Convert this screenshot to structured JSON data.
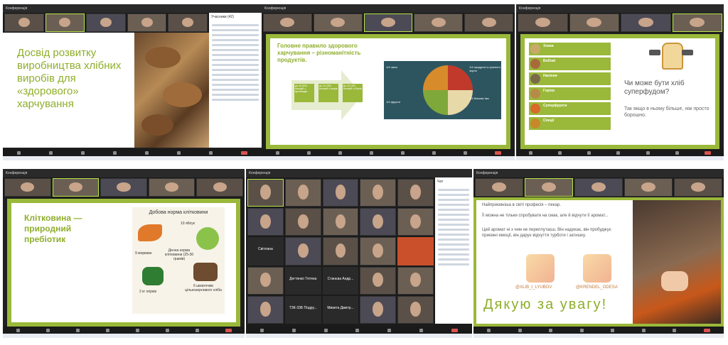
{
  "panels": {
    "p1": {
      "window_title": "Конференція",
      "slide_title": "Досвід розвитку виробництва хлібних виробів для «здорового» харчування",
      "participants_header": "Учасники (42)"
    },
    "p2": {
      "window_title": "Конференція",
      "slide_title": "Головне правило здорового харчування – різноманітність продуктів.",
      "arrow_boxes": [
        "до 40-60% калорій з вуглеводів",
        "до 10-15% калорій із жирів",
        "до 10-15% калорій із білків"
      ],
      "plate_labels": [
        "1/4 продукти із цільного зерна",
        "1/4 білкова їжа",
        "1/4 овочі",
        "1/4 фрукти"
      ]
    },
    "p3": {
      "window_title": "Конференція",
      "list_items": [
        "Злаки",
        "Бобові",
        "Насіння",
        "Горіхи",
        "Суперфрукти",
        "Спеції"
      ],
      "question": "Чи може бути хліб суперфудом?",
      "answer": "Так якщо в ньому більше, ніж просто борошно."
    },
    "p4": {
      "window_title": "Конференція",
      "slide_title": "Клітковина — природний пребіотик",
      "box_title": "Добова норма клітковини",
      "daily_norm": "Денна норма клітковини (25-30 грамів)",
      "labels": [
        "10 яблук",
        "9 морквин",
        "2 кг огірків",
        "6 шматочків цільнозернового хліба"
      ]
    },
    "p5": {
      "window_title": "Конференція",
      "names": [
        "Світлана",
        "Дегтянко Тетяна",
        "Станєва Андр...",
        "ТЗК-33Б Подру...",
        "Микита Дмитр..."
      ],
      "chat_header": "Чат"
    },
    "p6": {
      "window_title": "Конференція",
      "text1": "Найприємніша в світі професія – пекар.",
      "text2": "Її можна не тільки спробувати на смак, але й відчути її аромат...",
      "text3": "Цей аромат ні з чим не переплутаєш. Він надихає, він пробуджує приємні емоції, він дарує відчуття турботи і затишку.",
      "insta1": "@XLIB_I_LYUBOV",
      "insta2": "@KRENDEL_ODESA",
      "thanks": "Дякую за увагу!"
    }
  },
  "colors": {
    "accent": "#9ab83a",
    "title": "#8fae2b",
    "dark": "#1f1f1f"
  }
}
